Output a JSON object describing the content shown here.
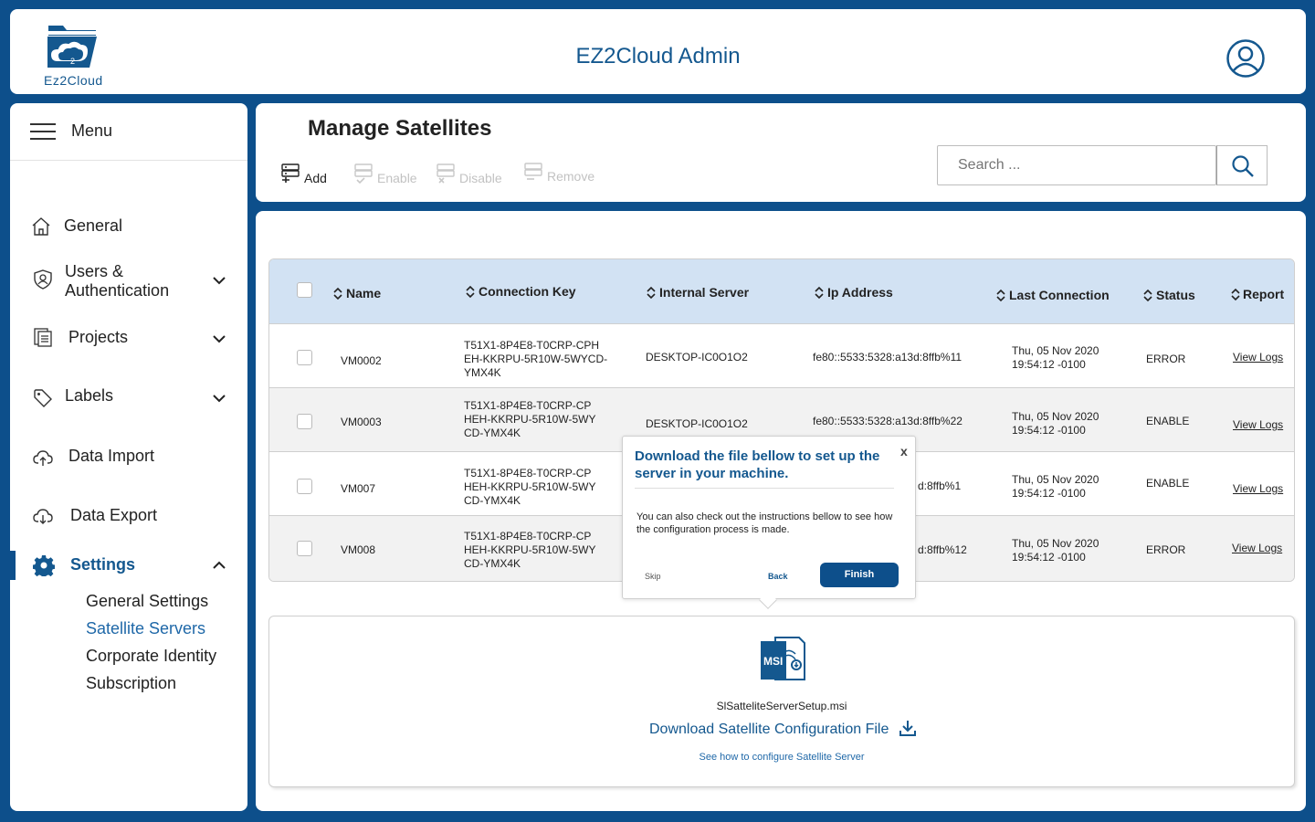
{
  "header": {
    "logo_text": "Ez2Cloud",
    "title": "EZ2Cloud Admin",
    "avatar_icon": "user-circle-icon"
  },
  "sidebar": {
    "menu_label": "Menu",
    "items": [
      {
        "label": "General",
        "icon": "home-icon"
      },
      {
        "label": "Users &",
        "label2": "Authentication",
        "icon": "shield-user-icon"
      },
      {
        "label": "Projects",
        "icon": "projects-icon"
      },
      {
        "label": "Labels",
        "icon": "tag-icon"
      },
      {
        "label": "Data Import",
        "icon": "cloud-upload-icon"
      },
      {
        "label": "Data Export",
        "icon": "cloud-download-icon"
      },
      {
        "label": "Settings",
        "icon": "gear-icon"
      }
    ],
    "settings_sub": [
      "General Settings",
      "Satellite Servers",
      "Corporate Identity",
      "Subscription"
    ],
    "active_sub": "Satellite Servers"
  },
  "toolbar": {
    "title": "Manage Satellites",
    "add": "Add",
    "enable": "Enable",
    "disable": "Disable",
    "remove": "Remove",
    "search_placeholder": "Search ..."
  },
  "table": {
    "columns": [
      "Name",
      "Connection Key",
      "Internal Server",
      "Ip Address",
      "Last Connection",
      "Status",
      "Report"
    ],
    "rows": [
      {
        "name": "VM0002",
        "key1": "T51X1-8P4E8-T0CRP-CPH",
        "key2": "EH-KKRPU-5R10W-5WYCD-",
        "key3": "YMX4K",
        "server": "DESKTOP-IC0O1O2",
        "ip": "fe80::5533:5328:a13d:8ffb%11",
        "date1": "Thu, 05 Nov 2020",
        "date2": "19:54:12 -0100",
        "status": "ERROR",
        "report": "View Logs"
      },
      {
        "name": "VM0003",
        "key1": "T51X1-8P4E8-T0CRP-CP",
        "key2": "HEH-KKRPU-5R10W-5WY",
        "key3": "CD-YMX4K",
        "server": "DESKTOP-IC0O1O2",
        "ip": "fe80::5533:5328:a13d:8ffb%22",
        "date1": "Thu, 05 Nov 2020",
        "date2": "19:54:12 -0100",
        "status": "ENABLE",
        "report": "View Logs"
      },
      {
        "name": "VM007",
        "key1": "T51X1-8P4E8-T0CRP-CP",
        "key2": "HEH-KKRPU-5R10W-5WY",
        "key3": "CD-YMX4K",
        "server": "",
        "ip": "d:8ffb%1",
        "date1": "Thu, 05 Nov 2020",
        "date2": "19:54:12 -0100",
        "status": "ENABLE",
        "report": "View Logs"
      },
      {
        "name": "VM008",
        "key1": "T51X1-8P4E8-T0CRP-CP",
        "key2": "HEH-KKRPU-5R10W-5WY",
        "key3": "CD-YMX4K",
        "server": "",
        "ip": "d:8ffb%12",
        "date1": "Thu, 05 Nov 2020",
        "date2": "19:54:12 -0100",
        "status": "ERROR",
        "report": "View Logs"
      }
    ]
  },
  "popup": {
    "title": "Download the file bellow to set up the server in your machine.",
    "close": "x",
    "body": "You can also check out the instructions bellow to see how the configuration process is made.",
    "skip": "Skip",
    "back": "Back",
    "finish": "Finish"
  },
  "download": {
    "icon_text": "MSI",
    "file_name": "SlSatteliteServerSetup.msi",
    "link": "Download Satellite Configuration File",
    "howto": "See how to configure Satellite Server"
  },
  "colors": {
    "brand": "#0d4f8b",
    "title_blue": "#14588f",
    "table_header": "#d2e2f3"
  }
}
